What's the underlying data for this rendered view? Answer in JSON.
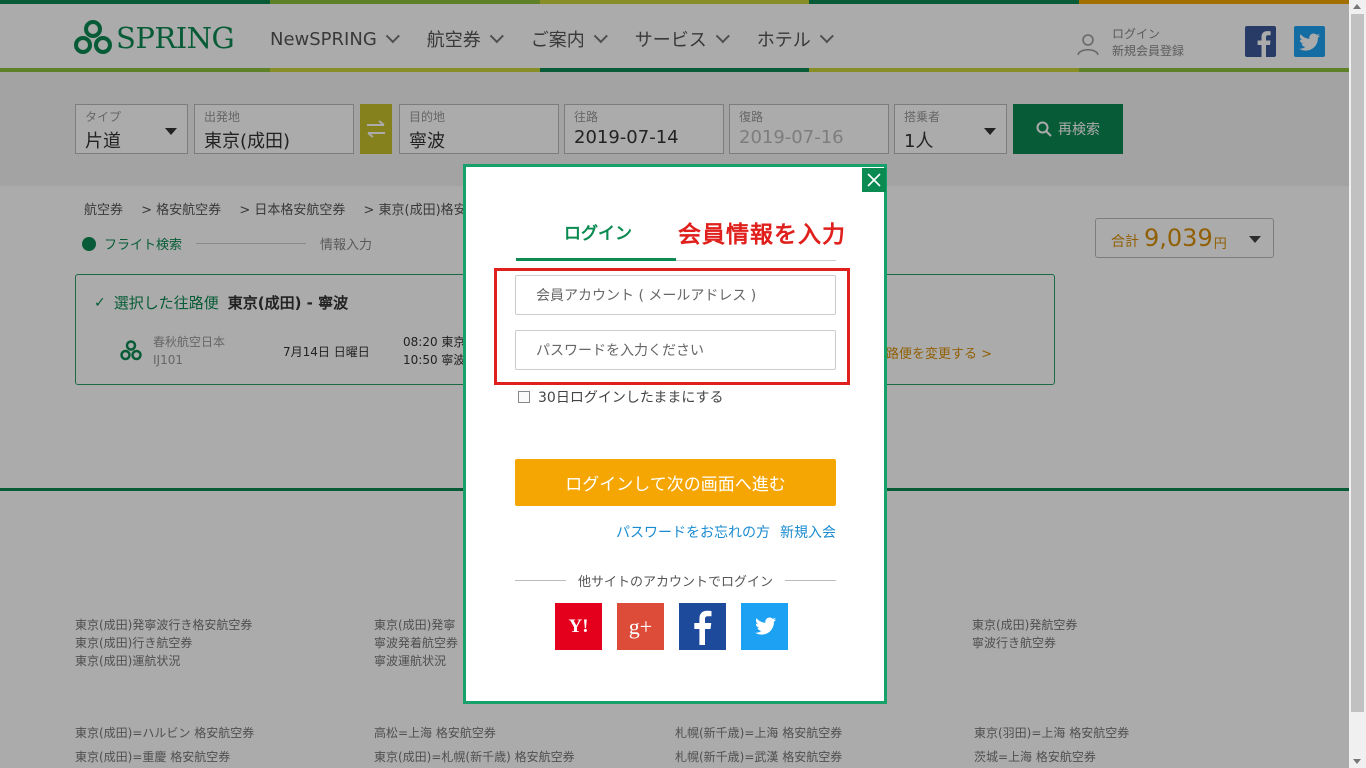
{
  "brand": {
    "name": "SPRING",
    "green": "#0b8a52",
    "orange": "#f5a603"
  },
  "nav": [
    {
      "label": "NewSPRING"
    },
    {
      "label": "航空券"
    },
    {
      "label": "ご案内"
    },
    {
      "label": "サービス"
    },
    {
      "label": "ホテル"
    }
  ],
  "header": {
    "login": "ログイン",
    "register": "新規会員登録",
    "social": [
      "facebook-icon",
      "twitter-icon"
    ]
  },
  "search": {
    "type": {
      "label": "タイプ",
      "value": "片道"
    },
    "from": {
      "label": "出発地",
      "value": "東京(成田)"
    },
    "to": {
      "label": "目的地",
      "value": "寧波"
    },
    "outbound": {
      "label": "往路",
      "value": "2019-07-14"
    },
    "return": {
      "label": "復路",
      "value": "2019-07-16"
    },
    "passengers": {
      "label": "搭乗者",
      "value": "1人"
    },
    "button": "再検索"
  },
  "breadcrumb": [
    "航空券",
    "> 格安航空券",
    "> 日本格安航空券",
    "> 東京(成田)格安"
  ],
  "steps": {
    "step1": "フライト検索",
    "step2": "情報入力"
  },
  "total": {
    "label": "合計",
    "amount": "9,039",
    "unit": "円"
  },
  "flight": {
    "title": "選択した往路便",
    "route": "東京(成田) - 寧波",
    "airline": "春秋航空日本",
    "number": "IJ101",
    "date": "7月14日 日曜日",
    "dep": "08:20 東京",
    "arr": "10:50 寧波",
    "change": "路便を変更する >"
  },
  "footer": {
    "col1": [
      "東京(成田)発寧波行き格安航空券",
      "東京(成田)行き航空券",
      "東京(成田)運航状況"
    ],
    "col2": [
      "東京(成田)発寧",
      "寧波発着航空券",
      "寧波運航状況"
    ],
    "col4": [
      "東京(成田)発航空券",
      "寧波行き航空券"
    ],
    "row2a": [
      "東京(成田)=ハルビン 格安航空券",
      "高松=上海 格安航空券",
      "札幌(新千歳)=上海 格安航空券",
      "東京(羽田)=上海 格安航空券"
    ],
    "row2b": [
      "東京(成田)=重慶 格安航空券",
      "東京(成田)=札幌(新千歳) 格安航空券",
      "札幌(新千歳)=武漢 格安航空券",
      "茨城=上海 格安航空券"
    ]
  },
  "modal": {
    "tab": "ログイン",
    "annotation": "会員情報を入力",
    "email_placeholder": "会員アカウント ( メールアドレス )",
    "password_placeholder": "パスワードを入力ください",
    "remember": "30日ログインしたままにする",
    "submit": "ログインして次の画面へ進む",
    "forgot": "パスワードをお忘れの方",
    "register": "新規入会",
    "other": "他サイトのアカウントでログイン",
    "sns": [
      {
        "name": "yahoo",
        "label": "Y!"
      },
      {
        "name": "google-plus",
        "label": "g+"
      },
      {
        "name": "facebook",
        "label": "f"
      },
      {
        "name": "twitter",
        "label": "twitter"
      }
    ]
  }
}
